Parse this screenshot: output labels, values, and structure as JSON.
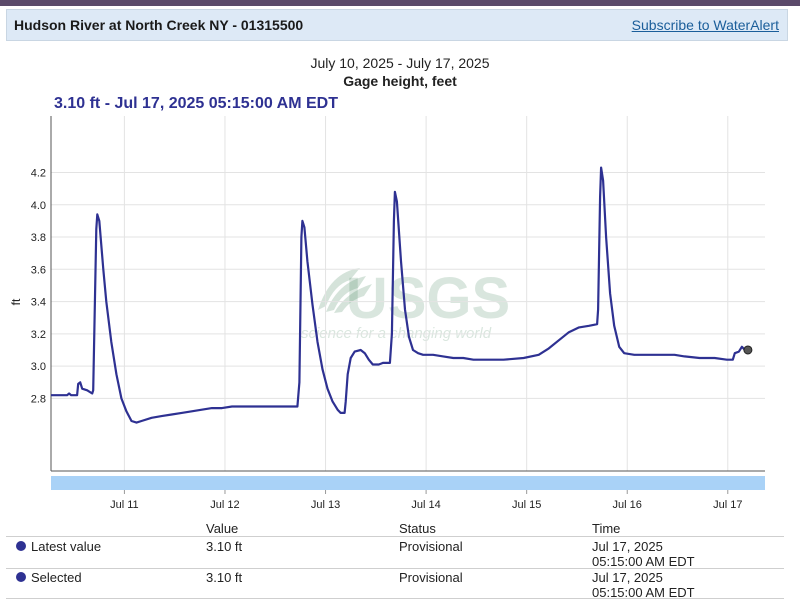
{
  "header": {
    "title": "Hudson River at North Creek NY - 01315500",
    "subscribe": "Subscribe to WaterAlert"
  },
  "chart_heading": {
    "date_range": "July 10, 2025 - July 17, 2025",
    "parameter": "Gage height, feet",
    "readout": "3.10 ft - Jul 17, 2025 05:15:00 AM EDT"
  },
  "watermark": {
    "logo": "USGS",
    "tagline": "science for a changing world"
  },
  "chart_data": {
    "type": "line",
    "ylabel": "ft",
    "ylim": [
      2.35,
      4.55
    ],
    "xlim": [
      0,
      7.1
    ],
    "yticks": [
      2.8,
      3.0,
      3.2,
      3.4,
      3.6,
      3.8,
      4.0,
      4.2
    ],
    "xticks": [
      {
        "x": 0.73,
        "label": "Jul 11"
      },
      {
        "x": 1.73,
        "label": "Jul 12"
      },
      {
        "x": 2.73,
        "label": "Jul 13"
      },
      {
        "x": 3.73,
        "label": "Jul 14"
      },
      {
        "x": 4.73,
        "label": "Jul 15"
      },
      {
        "x": 5.73,
        "label": "Jul 16"
      },
      {
        "x": 6.73,
        "label": "Jul 17"
      }
    ],
    "grid": true,
    "series": [
      {
        "color": "#2e3192",
        "points": [
          [
            0.0,
            2.82
          ],
          [
            0.16,
            2.82
          ],
          [
            0.18,
            2.83
          ],
          [
            0.2,
            2.82
          ],
          [
            0.26,
            2.82
          ],
          [
            0.27,
            2.89
          ],
          [
            0.29,
            2.9
          ],
          [
            0.31,
            2.86
          ],
          [
            0.36,
            2.85
          ],
          [
            0.41,
            2.83
          ],
          [
            0.42,
            2.85
          ],
          [
            0.45,
            3.85
          ],
          [
            0.46,
            3.94
          ],
          [
            0.48,
            3.9
          ],
          [
            0.52,
            3.6
          ],
          [
            0.55,
            3.4
          ],
          [
            0.6,
            3.15
          ],
          [
            0.65,
            2.95
          ],
          [
            0.7,
            2.8
          ],
          [
            0.75,
            2.72
          ],
          [
            0.8,
            2.66
          ],
          [
            0.85,
            2.65
          ],
          [
            0.9,
            2.66
          ],
          [
            1.0,
            2.68
          ],
          [
            1.1,
            2.69
          ],
          [
            1.2,
            2.7
          ],
          [
            1.3,
            2.71
          ],
          [
            1.4,
            2.72
          ],
          [
            1.5,
            2.73
          ],
          [
            1.6,
            2.74
          ],
          [
            1.7,
            2.74
          ],
          [
            1.8,
            2.75
          ],
          [
            2.0,
            2.75
          ],
          [
            2.2,
            2.75
          ],
          [
            2.4,
            2.75
          ],
          [
            2.45,
            2.75
          ],
          [
            2.47,
            2.9
          ],
          [
            2.49,
            3.8
          ],
          [
            2.5,
            3.9
          ],
          [
            2.52,
            3.86
          ],
          [
            2.55,
            3.65
          ],
          [
            2.6,
            3.38
          ],
          [
            2.65,
            3.15
          ],
          [
            2.7,
            2.98
          ],
          [
            2.75,
            2.86
          ],
          [
            2.8,
            2.78
          ],
          [
            2.85,
            2.73
          ],
          [
            2.88,
            2.71
          ],
          [
            2.92,
            2.71
          ],
          [
            2.93,
            2.78
          ],
          [
            2.95,
            2.95
          ],
          [
            2.98,
            3.05
          ],
          [
            3.02,
            3.09
          ],
          [
            3.08,
            3.1
          ],
          [
            3.12,
            3.08
          ],
          [
            3.16,
            3.04
          ],
          [
            3.2,
            3.01
          ],
          [
            3.26,
            3.01
          ],
          [
            3.3,
            3.02
          ],
          [
            3.37,
            3.02
          ],
          [
            3.39,
            3.2
          ],
          [
            3.41,
            3.9
          ],
          [
            3.42,
            4.08
          ],
          [
            3.44,
            4.02
          ],
          [
            3.48,
            3.65
          ],
          [
            3.52,
            3.35
          ],
          [
            3.56,
            3.18
          ],
          [
            3.6,
            3.1
          ],
          [
            3.65,
            3.08
          ],
          [
            3.7,
            3.07
          ],
          [
            3.8,
            3.07
          ],
          [
            3.9,
            3.06
          ],
          [
            4.0,
            3.05
          ],
          [
            4.1,
            3.05
          ],
          [
            4.2,
            3.04
          ],
          [
            4.35,
            3.04
          ],
          [
            4.5,
            3.04
          ],
          [
            4.7,
            3.05
          ],
          [
            4.85,
            3.07
          ],
          [
            4.95,
            3.11
          ],
          [
            5.05,
            3.16
          ],
          [
            5.15,
            3.21
          ],
          [
            5.25,
            3.24
          ],
          [
            5.35,
            3.25
          ],
          [
            5.43,
            3.26
          ],
          [
            5.44,
            3.35
          ],
          [
            5.46,
            4.05
          ],
          [
            5.47,
            4.23
          ],
          [
            5.49,
            4.15
          ],
          [
            5.52,
            3.8
          ],
          [
            5.56,
            3.45
          ],
          [
            5.6,
            3.25
          ],
          [
            5.65,
            3.12
          ],
          [
            5.7,
            3.08
          ],
          [
            5.8,
            3.07
          ],
          [
            6.0,
            3.07
          ],
          [
            6.2,
            3.07
          ],
          [
            6.3,
            3.06
          ],
          [
            6.45,
            3.05
          ],
          [
            6.6,
            3.05
          ],
          [
            6.72,
            3.04
          ],
          [
            6.78,
            3.04
          ],
          [
            6.8,
            3.08
          ],
          [
            6.84,
            3.09
          ],
          [
            6.87,
            3.12
          ],
          [
            6.9,
            3.1
          ],
          [
            6.93,
            3.1
          ]
        ]
      }
    ],
    "marker": {
      "x": 6.93,
      "y": 3.1
    }
  },
  "table": {
    "headers": {
      "value": "Value",
      "status": "Status",
      "time": "Time"
    },
    "rows": [
      {
        "label": "Latest value",
        "value": "3.10 ft",
        "status": "Provisional",
        "date": "Jul 17, 2025",
        "time": "05:15:00 AM EDT"
      },
      {
        "label": "Selected",
        "value": "3.10 ft",
        "status": "Provisional",
        "date": "Jul 17, 2025",
        "time": "05:15:00 AM EDT"
      }
    ]
  }
}
